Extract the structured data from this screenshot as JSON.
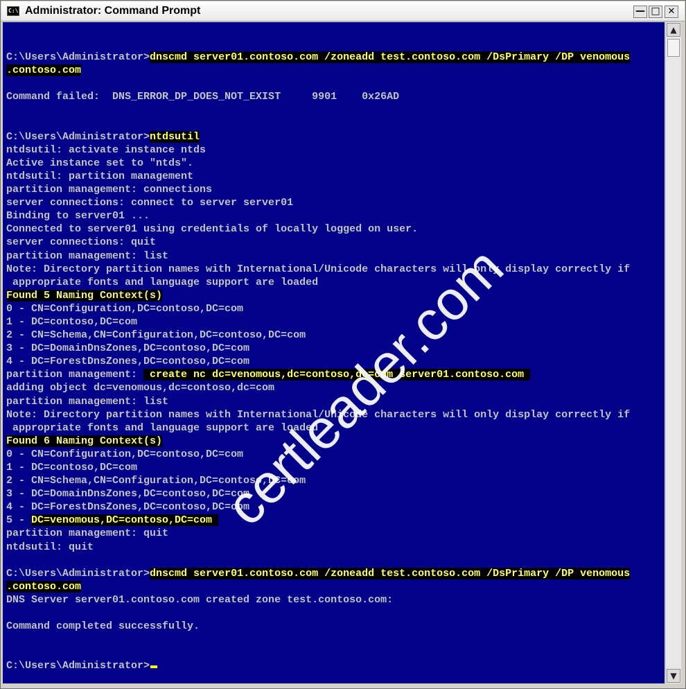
{
  "window": {
    "title": "Administrator: Command Prompt",
    "icon": "console-app-icon",
    "icon_text": "C:\\.",
    "controls": {
      "minimize": "—",
      "maximize": "□",
      "close": "✕"
    }
  },
  "console": {
    "background": "#01018a",
    "text_color": "#c3c3c3",
    "highlight_color": "#ffff66",
    "lines": [
      {
        "segments": [
          {
            "t": ""
          }
        ]
      },
      {
        "segments": [
          {
            "t": "C:\\Users\\Administrator>"
          },
          {
            "t": "dnscmd server01.contoso.com /zoneadd test.contoso.com /DsPrimary /DP venomous",
            "h": 1
          }
        ]
      },
      {
        "segments": [
          {
            "t": ".contoso.com",
            "h": 1
          }
        ]
      },
      {
        "segments": [
          {
            "t": ""
          }
        ]
      },
      {
        "segments": [
          {
            "t": "Command failed:  DNS_ERROR_DP_DOES_NOT_EXIST     9901    0x26AD"
          }
        ]
      },
      {
        "segments": [
          {
            "t": ""
          }
        ]
      },
      {
        "segments": [
          {
            "t": ""
          }
        ]
      },
      {
        "segments": [
          {
            "t": "C:\\Users\\Administrator>"
          },
          {
            "t": "ntdsutil",
            "h": 1
          }
        ]
      },
      {
        "segments": [
          {
            "t": "ntdsutil: activate instance ntds"
          }
        ]
      },
      {
        "segments": [
          {
            "t": "Active instance set to \"ntds\"."
          }
        ]
      },
      {
        "segments": [
          {
            "t": "ntdsutil: partition management"
          }
        ]
      },
      {
        "segments": [
          {
            "t": "partition management: connections"
          }
        ]
      },
      {
        "segments": [
          {
            "t": "server connections: connect to server server01"
          }
        ]
      },
      {
        "segments": [
          {
            "t": "Binding to server01 ..."
          }
        ]
      },
      {
        "segments": [
          {
            "t": "Connected to server01 using credentials of locally logged on user."
          }
        ]
      },
      {
        "segments": [
          {
            "t": "server connections: quit"
          }
        ]
      },
      {
        "segments": [
          {
            "t": "partition management: list"
          }
        ]
      },
      {
        "segments": [
          {
            "t": "Note: Directory partition names with International/Unicode characters will only display correctly if"
          }
        ]
      },
      {
        "segments": [
          {
            "t": " appropriate fonts and language support are loaded"
          }
        ]
      },
      {
        "segments": [
          {
            "t": "Found 5 Naming Context(s)",
            "h": 2
          }
        ]
      },
      {
        "segments": [
          {
            "t": "0 - CN=Configuration,DC=contoso,DC=com"
          }
        ]
      },
      {
        "segments": [
          {
            "t": "1 - DC=contoso,DC=com"
          }
        ]
      },
      {
        "segments": [
          {
            "t": "2 - CN=Schema,CN=Configuration,DC=contoso,DC=com"
          }
        ]
      },
      {
        "segments": [
          {
            "t": "3 - DC=DomainDnsZones,DC=contoso,DC=com"
          }
        ]
      },
      {
        "segments": [
          {
            "t": "4 - DC=ForestDnsZones,DC=contoso,DC=com"
          }
        ]
      },
      {
        "segments": [
          {
            "t": "partition management: "
          },
          {
            "t": " create nc dc=venomous,dc=contoso,dc=com server01.contoso.com ",
            "h": 1
          }
        ]
      },
      {
        "segments": [
          {
            "t": "adding object dc=venomous,dc=contoso,dc=com"
          }
        ]
      },
      {
        "segments": [
          {
            "t": "partition management: list"
          }
        ]
      },
      {
        "segments": [
          {
            "t": "Note: Directory partition names with International/Unicode characters will only display correctly if"
          }
        ]
      },
      {
        "segments": [
          {
            "t": " appropriate fonts and language support are loaded"
          }
        ]
      },
      {
        "segments": [
          {
            "t": "Found 6 Naming Context(s)",
            "h": 2
          }
        ]
      },
      {
        "segments": [
          {
            "t": "0 - CN=Configuration,DC=contoso,DC=com"
          }
        ]
      },
      {
        "segments": [
          {
            "t": "1 - DC=contoso,DC=com"
          }
        ]
      },
      {
        "segments": [
          {
            "t": "2 - CN=Schema,CN=Configuration,DC=contoso,DC=com"
          }
        ]
      },
      {
        "segments": [
          {
            "t": "3 - DC=DomainDnsZones,DC=contoso,DC=com"
          }
        ]
      },
      {
        "segments": [
          {
            "t": "4 - DC=ForestDnsZones,DC=contoso,DC=com"
          }
        ]
      },
      {
        "segments": [
          {
            "t": "5 - "
          },
          {
            "t": "DC=venomous,DC=contoso,DC=com ",
            "h": 1
          }
        ]
      },
      {
        "segments": [
          {
            "t": "partition management: quit"
          }
        ]
      },
      {
        "segments": [
          {
            "t": "ntdsutil: quit"
          }
        ]
      },
      {
        "segments": [
          {
            "t": ""
          }
        ]
      },
      {
        "segments": [
          {
            "t": "C:\\Users\\Administrator>"
          },
          {
            "t": "dnscmd server01.contoso.com /zoneadd test.contoso.com /DsPrimary /DP venomous",
            "h": 1
          }
        ]
      },
      {
        "segments": [
          {
            "t": ".contoso.com",
            "h": 1
          }
        ]
      },
      {
        "segments": [
          {
            "t": "DNS Server server01.contoso.com created zone test.contoso.com:"
          }
        ]
      },
      {
        "segments": [
          {
            "t": ""
          }
        ]
      },
      {
        "segments": [
          {
            "t": "Command completed successfully."
          }
        ]
      },
      {
        "segments": [
          {
            "t": ""
          }
        ]
      },
      {
        "segments": [
          {
            "t": ""
          }
        ]
      },
      {
        "segments": [
          {
            "t": "C:\\Users\\Administrator>"
          }
        ],
        "cursor": true
      }
    ]
  },
  "scrollbar": {
    "up_arrow": "▲",
    "down_arrow": "▼"
  },
  "watermark": {
    "text": "certleader.com"
  }
}
